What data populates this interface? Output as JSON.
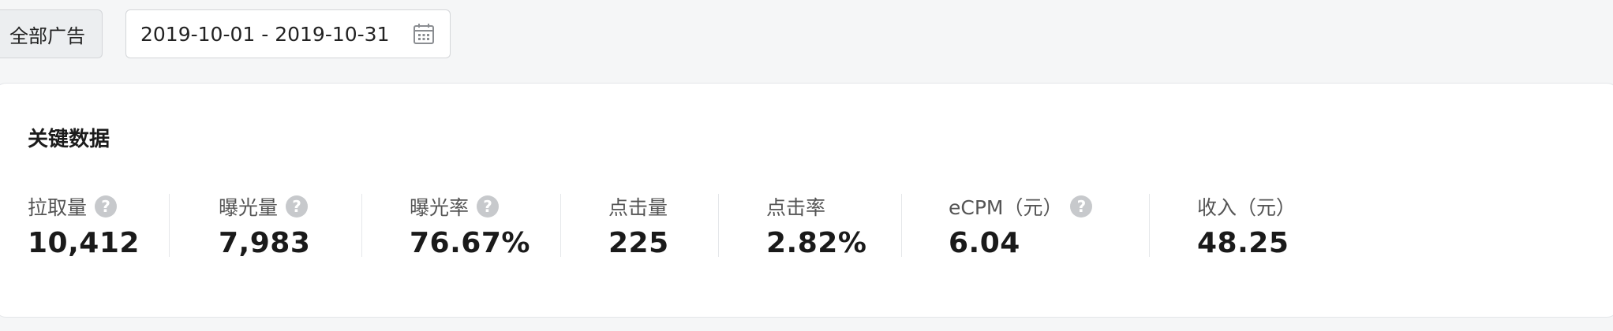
{
  "toolbar": {
    "filter_label": "全部广告",
    "date_range": "2019-10-01 - 2019-10-31"
  },
  "key_data": {
    "title": "关键数据",
    "metrics": [
      {
        "label": "拉取量",
        "value": "10,412",
        "help": true
      },
      {
        "label": "曝光量",
        "value": "7,983",
        "help": true
      },
      {
        "label": "曝光率",
        "value": "76.67%",
        "help": true
      },
      {
        "label": "点击量",
        "value": "225",
        "help": false
      },
      {
        "label": "点击率",
        "value": "2.82%",
        "help": false
      },
      {
        "label": "eCPM（元）",
        "value": "6.04",
        "help": true
      },
      {
        "label": "收入（元）",
        "value": "48.25",
        "help": false
      }
    ]
  },
  "icons": {
    "help": "question-circle-icon",
    "calendar": "calendar-icon"
  },
  "colors": {
    "background": "#f5f6f7",
    "card": "#ffffff",
    "help_icon": "#c7c9cc",
    "value_text": "#1a1a1a",
    "label_text": "#555555"
  }
}
